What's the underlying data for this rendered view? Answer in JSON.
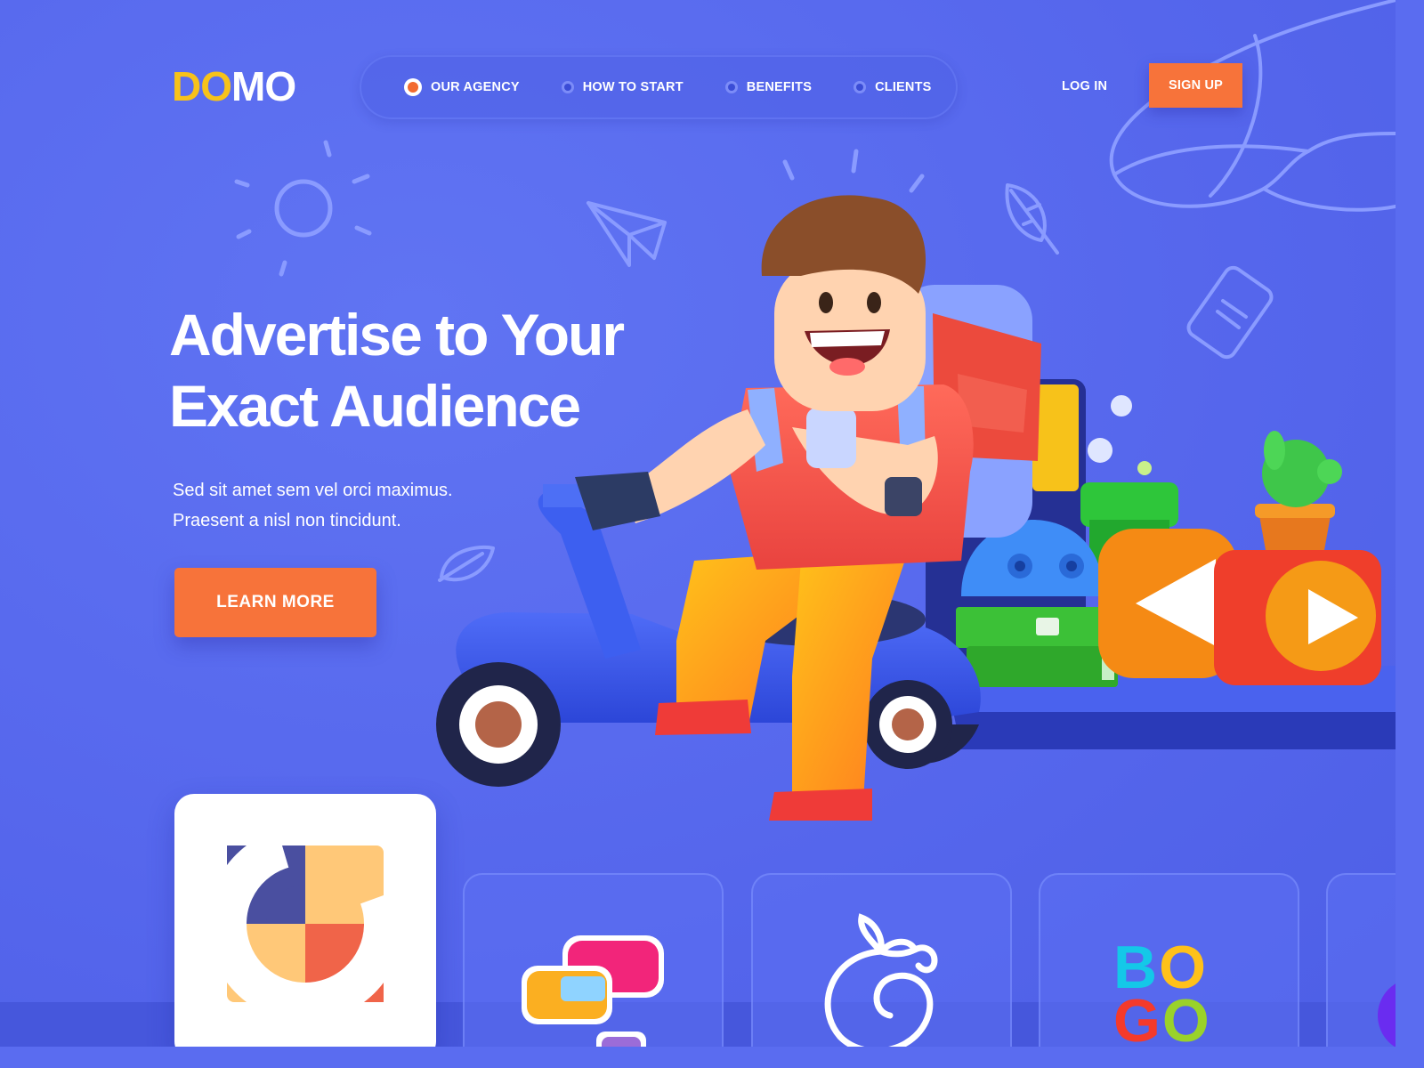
{
  "brand": {
    "logo_part1": "DO",
    "logo_part2": "MO"
  },
  "nav": {
    "items": [
      {
        "label": "OUR AGENCY",
        "active": true
      },
      {
        "label": "HOW TO START",
        "active": false
      },
      {
        "label": "BENEFITS",
        "active": false
      },
      {
        "label": "CLIENTS",
        "active": false
      }
    ]
  },
  "auth": {
    "login_label": "LOG IN",
    "signup_label": "SIGN UP"
  },
  "hero": {
    "title_line1": "Advertise to Your",
    "title_line2": "Exact Audience",
    "subtitle_line1": "Sed sit amet sem vel orci maximus.",
    "subtitle_line2": "Praesent a nisl non tincidunt.",
    "cta_label": "LEARN MORE"
  },
  "cards": {
    "bogo_row1": [
      "B",
      "O"
    ],
    "bogo_row2": [
      "G",
      "O"
    ]
  },
  "colors": {
    "background": "#5a6cf0",
    "accent_orange": "#f7733a",
    "logo_yellow": "#f7c21a"
  },
  "icons": [
    "sun-doodle-icon",
    "paper-plane-doodle-icon",
    "leaf-doodle-icon",
    "note-doodle-icon",
    "play-icon",
    "rewind-icon"
  ]
}
